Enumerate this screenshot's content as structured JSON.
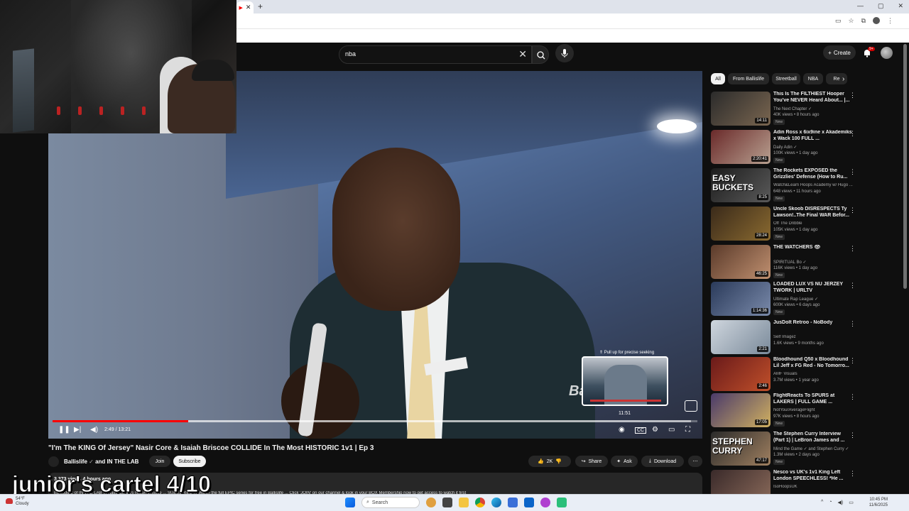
{
  "browser": {
    "tab_close": "✕",
    "new_tab": "+",
    "window_controls": [
      "—",
      "▢",
      "✕"
    ]
  },
  "header": {
    "search_query": "nba",
    "create_label": "Create",
    "notification_count": "9+"
  },
  "player": {
    "watermark": "Ba",
    "preview_hint": "⇑ Pull up for precise seeking",
    "preview_time": "11:51",
    "time_display": "2:49 / 13:21",
    "progress_played_fraction": 0.21,
    "progress_buffered_fraction": 0.99
  },
  "video": {
    "title": "\"I'm The KING Of Jersey\" Nasir Core & Isaiah Briscoe COLLIDE In The Most HISTORIC 1v1 | Ep 3",
    "channel": "Ballislife",
    "channel_and": "and IN THE LAB",
    "join_label": "Join",
    "subscribe_label": "Subscribe",
    "likes": "2K",
    "share_label": "Share",
    "ask_label": "Ask",
    "download_label": "Download",
    "desc_stats": "3,373 views  4 hours ago",
    "desc_line": "Episode 3 of IN THE LAB ... Nasir Core vs Isaiah Briscoe ... SUBSCRIBE ... Watch the full EPIC series for free in Ballislife ... Click 'JOIN' on our channel & look in your BOX Membership now to get access to watch it first"
  },
  "overlay_text": "junior's cartel 4/10",
  "chips": [
    "All",
    "From Ballislife",
    "Streetball",
    "NBA",
    "Re"
  ],
  "sidebar": [
    {
      "title": "This Is The FILTHIEST Hooper You've NEVER Heard About... |...",
      "channel": "The Next Chapter ✓",
      "meta": "40K views • 8 hours ago",
      "badge": "New",
      "duration": "14:11",
      "thumb_text": "",
      "color1": "#2b2b2b",
      "color2": "#7a6650"
    },
    {
      "title": "Adin Ross x 6ix9ine x Akademiks x Wack 100 FULL ...",
      "channel": "Daily Adin ✓",
      "meta": "100K views • 1 day ago",
      "badge": "New",
      "duration": "2:20:41",
      "thumb_text": "",
      "color1": "#6a2a2a",
      "color2": "#b8a090"
    },
    {
      "title": "The Rockets EXPOSED the Grizzlies' Defense (How to Ru...",
      "channel": "Watch&Learn Hoops Academy w/ Hugo ...",
      "meta": "648 views • 11 hours ago",
      "badge": "New",
      "duration": "8:25",
      "thumb_text": "EASY BUCKETS",
      "color1": "#1c1c1c",
      "color2": "#5a5a5a"
    },
    {
      "title": "Uncle Skoob DISRESPECTS Ty Lawson!..The Final WAR Befor...",
      "channel": "Off The Dribble",
      "meta": "105K views • 1 day ago",
      "badge": "New",
      "duration": "28:24",
      "thumb_text": "",
      "color1": "#3a2a1a",
      "color2": "#8a6a30"
    },
    {
      "title": "THE WATCHERS 👁",
      "channel": "SPIRITUAL Bo ✓",
      "meta": "116K views • 1 day ago",
      "badge": "New",
      "duration": "46:25",
      "thumb_text": "",
      "color1": "#5a3a2a",
      "color2": "#c09070"
    },
    {
      "title": "LOADED LUX VS NU JERZEY TWORK | URLTV",
      "channel": "Ultimate Rap League ✓",
      "meta": "600K views • 6 days ago",
      "badge": "New",
      "duration": "1:14:36",
      "thumb_text": "",
      "color1": "#2a3a5a",
      "color2": "#7a8aaa"
    },
    {
      "title": "JusDoIt Retroo - NoBody",
      "channel": "Self Imagez",
      "meta": "1.6K views • 9 months ago",
      "badge": "",
      "duration": "2:21",
      "thumb_text": "",
      "color1": "#cfd6de",
      "color2": "#7a8a9a"
    },
    {
      "title": "Bloodhound Q50 x Bloodhound Lil Jeff x FG Red - No Tomorro...",
      "channel": "AMF Visuals",
      "meta": "3.7M views • 1 year ago",
      "badge": "",
      "duration": "2:46",
      "thumb_text": "",
      "color1": "#6a1a1a",
      "color2": "#c0502a"
    },
    {
      "title": "FlightReacts To SPURS at LAKERS | FULL GAME ...",
      "channel": "NotYourAverageFlight",
      "meta": "97K views • 8 hours ago",
      "badge": "New",
      "duration": "17:05",
      "thumb_text": "",
      "color1": "#4a3a6a",
      "color2": "#d0b060"
    },
    {
      "title": "The Stephen Curry Interview (Part 1) | LeBron James and ...",
      "channel": "Mind the Game ✓ and Stephen Curry ✓",
      "meta": "1.3M views • 2 days ago",
      "badge": "New",
      "duration": "47:17",
      "thumb_text": "STEPHEN CURRY",
      "color1": "#2a2a2a",
      "color2": "#a08060"
    },
    {
      "title": "Nesco vs UK's 1v1 King Left London SPEECHLESS! *He ...",
      "channel": "IsoHoopsUK",
      "meta": "",
      "badge": "",
      "duration": "",
      "thumb_text": "",
      "color1": "#3a2a2a",
      "color2": "#8a6a5a"
    }
  ],
  "taskbar": {
    "weather_temp": "54°F",
    "weather_cond": "Cloudy",
    "search_label": "Search",
    "time": "10:45 PM",
    "date": "11/6/2025"
  },
  "colors": {
    "youtube_red": "#ff0000",
    "bg": "#0f0f0f",
    "chip_bg": "#272727"
  }
}
